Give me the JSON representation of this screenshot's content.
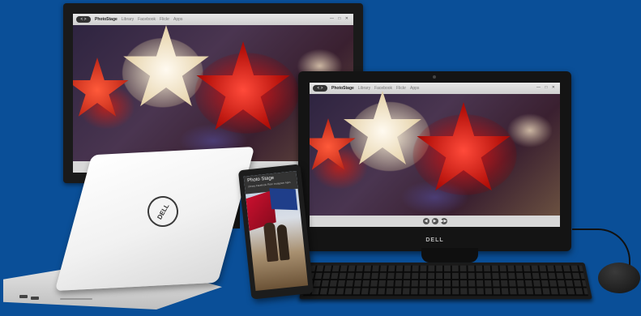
{
  "scene": {
    "background_color": "#0a4f98",
    "devices": [
      "monitor",
      "all-in-one",
      "laptop",
      "phone",
      "keyboard",
      "mouse"
    ]
  },
  "photostage_app": {
    "brand": "PhotoStage",
    "tabs": [
      "Library",
      "Facebook",
      "Flickr",
      "Apps"
    ],
    "back_forward": "< >",
    "window_controls": "— □ ✕",
    "playback_controls": [
      "◀",
      "▶",
      "▶▶"
    ]
  },
  "phone_app": {
    "title": "Photo Stage",
    "menu": "Library   Facebook   Flickr   Instagram   Apps"
  },
  "brand_logo": "DELL"
}
